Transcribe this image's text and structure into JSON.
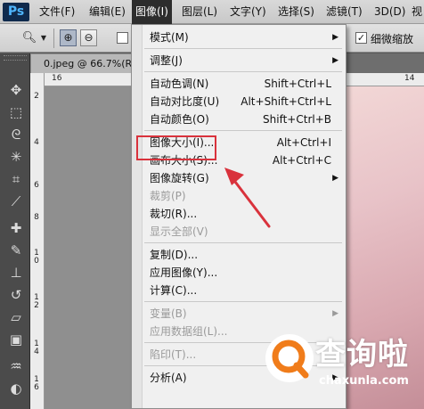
{
  "app": {
    "logo": "Ps"
  },
  "menubar": {
    "items": [
      {
        "label": "文件(F)"
      },
      {
        "label": "编辑(E)"
      },
      {
        "label": "图像(I)",
        "active": true
      },
      {
        "label": "图层(L)"
      },
      {
        "label": "文字(Y)"
      },
      {
        "label": "选择(S)"
      },
      {
        "label": "滤镜(T)"
      },
      {
        "label": "3D(D)"
      },
      {
        "label": "视"
      }
    ]
  },
  "options_bar": {
    "tool_icon": "zoom-icon",
    "zoom_in_icon": "zoom-in-icon",
    "zoom_out_icon": "zoom-out-icon",
    "scrubby_zoom_label": "细微缩放",
    "scrubby_zoom_checked": true
  },
  "document": {
    "tab_title": "0.jpeg @ 66.7%(R",
    "ruler_h_ticks": [
      "16",
      "14"
    ],
    "ruler_v_ticks": [
      "2",
      "4",
      "6",
      "8",
      "1 0",
      "1 2",
      "1 4",
      "1 6"
    ]
  },
  "toolbar": {
    "tools": [
      "move-icon",
      "marquee-icon",
      "lasso-icon",
      "magic-wand-icon",
      "crop-icon",
      "eyedropper-icon",
      "healing-brush-icon",
      "brush-icon",
      "clone-stamp-icon",
      "history-brush-icon",
      "eraser-icon",
      "gradient-icon",
      "blur-icon",
      "dodge-icon",
      "pen-icon"
    ]
  },
  "image_menu": {
    "items": [
      {
        "label": "模式(M)",
        "shortcut": "",
        "submenu": true,
        "disabled": false
      },
      {
        "separator": true
      },
      {
        "label": "调整(J)",
        "shortcut": "",
        "submenu": true,
        "disabled": false
      },
      {
        "separator": true
      },
      {
        "label": "自动色调(N)",
        "shortcut": "Shift+Ctrl+L",
        "submenu": false,
        "disabled": false
      },
      {
        "label": "自动对比度(U)",
        "shortcut": "Alt+Shift+Ctrl+L",
        "submenu": false,
        "disabled": false
      },
      {
        "label": "自动颜色(O)",
        "shortcut": "Shift+Ctrl+B",
        "submenu": false,
        "disabled": false
      },
      {
        "separator": true
      },
      {
        "label": "图像大小(I)...",
        "shortcut": "Alt+Ctrl+I",
        "submenu": false,
        "disabled": false,
        "highlighted": true
      },
      {
        "label": "画布大小(S)...",
        "shortcut": "Alt+Ctrl+C",
        "submenu": false,
        "disabled": false
      },
      {
        "label": "图像旋转(G)",
        "shortcut": "",
        "submenu": true,
        "disabled": false
      },
      {
        "label": "裁剪(P)",
        "shortcut": "",
        "submenu": false,
        "disabled": true
      },
      {
        "label": "裁切(R)...",
        "shortcut": "",
        "submenu": false,
        "disabled": false
      },
      {
        "label": "显示全部(V)",
        "shortcut": "",
        "submenu": false,
        "disabled": true
      },
      {
        "separator": true
      },
      {
        "label": "复制(D)...",
        "shortcut": "",
        "submenu": false,
        "disabled": false
      },
      {
        "label": "应用图像(Y)...",
        "shortcut": "",
        "submenu": false,
        "disabled": false
      },
      {
        "label": "计算(C)...",
        "shortcut": "",
        "submenu": false,
        "disabled": false
      },
      {
        "separator": true
      },
      {
        "label": "变量(B)",
        "shortcut": "",
        "submenu": true,
        "disabled": true
      },
      {
        "label": "应用数据组(L)...",
        "shortcut": "",
        "submenu": false,
        "disabled": true
      },
      {
        "separator": true
      },
      {
        "label": "陷印(T)...",
        "shortcut": "",
        "submenu": false,
        "disabled": true
      },
      {
        "separator": true
      },
      {
        "label": "分析(A)",
        "shortcut": "",
        "submenu": true,
        "disabled": false
      }
    ]
  },
  "annotation": {
    "color": "#d9323c"
  },
  "watermark": {
    "text_cn": "查询啦",
    "text_en": "chaxunla.com",
    "accent": "#f07c1a"
  }
}
